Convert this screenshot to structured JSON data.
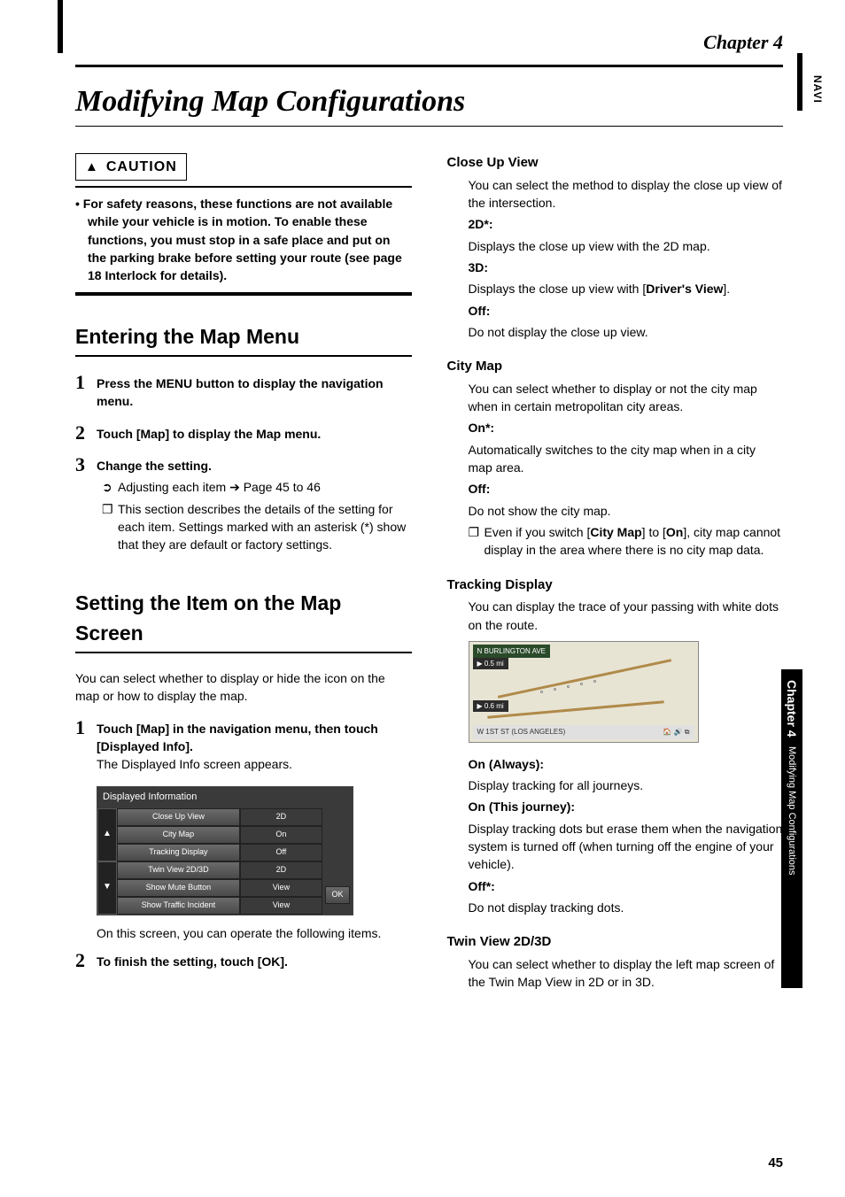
{
  "side_vert": "NAVI",
  "chapter": "Chapter 4",
  "title": "Modifying Map Configurations",
  "caution": {
    "label": "CAUTION",
    "text": "For safety reasons, these functions are not available while your vehicle is in motion. To enable these functions, you must stop in a safe place and put on the parking brake before setting your route (see page 18 Interlock for details)."
  },
  "h_enter": "Entering the Map Menu",
  "steps_a": {
    "s1": "Press the MENU button to display the navigation menu.",
    "s2": "Touch [Map] to display the Map menu.",
    "s3": "Change the setting.",
    "s3a_arrow": "Adjusting each item ➔ Page 45 to 46",
    "s3b": "This section describes the details of the setting for each item. Settings marked with an asterisk (*) show that they are default or factory settings."
  },
  "h_setting": "Setting the Item on the Map Screen",
  "setting_intro": "You can select whether to display or hide the icon on the map or how to display the map.",
  "steps_b": {
    "s1": "Touch [Map] in the navigation menu, then touch [Displayed Info].",
    "s1_sub": "The Displayed Info screen appears.",
    "s1_after": "On this screen, you can operate the following items.",
    "s2": "To finish the setting, touch [OK]."
  },
  "screenshot": {
    "title": "Displayed Information",
    "items": [
      {
        "label": "Close Up View",
        "value": "2D"
      },
      {
        "label": "City Map",
        "value": "On"
      },
      {
        "label": "Tracking Display",
        "value": "Off"
      },
      {
        "label": "Twin View 2D/3D",
        "value": "2D"
      },
      {
        "label": "Show Mute Button",
        "value": "View"
      },
      {
        "label": "Show Traffic Incident",
        "value": "View"
      }
    ],
    "ok": "OK"
  },
  "closeup": {
    "h": "Close Up View",
    "intro": "You can select the method to display the close up view of the intersection.",
    "k1": "2D*:",
    "v1": "Displays the close up view with the 2D map.",
    "k2": "3D:",
    "v2a": "Displays the close up view with [",
    "v2b": "Driver's View",
    "v2c": "].",
    "k3": "Off:",
    "v3": "Do not display the close up view."
  },
  "citymap": {
    "h": "City Map",
    "intro": "You can select whether to display or not the city map when in certain metropolitan city areas.",
    "k1": "On*:",
    "v1": "Automatically switches to the city map when in a city map area.",
    "k2": "Off:",
    "v2": "Do not show the city map.",
    "note_a": "Even if you switch [",
    "note_b": "City Map",
    "note_c": "] to [",
    "note_d": "On",
    "note_e": "], city map cannot display in the area where there is no city map data."
  },
  "tracking": {
    "h": "Tracking Display",
    "intro": "You can display the trace of your passing with white dots on the route.",
    "k1": "On (Always):",
    "v1": "Display tracking for all journeys.",
    "k2": "On (This journey):",
    "v2": "Display tracking dots but erase them when the navigation system is turned off (when turning off the engine of your vehicle).",
    "k3": "Off*:",
    "v3": "Do not display tracking dots."
  },
  "mapshot": {
    "top": "N BURLINGTON AVE",
    "mi1": "▶ 0.5 mi",
    "mi2": "▶ 0.6 mi",
    "bot_l": "W 1ST ST (LOS ANGELES)"
  },
  "twin": {
    "h": "Twin View 2D/3D",
    "intro": "You can select whether to display the left map screen of the Twin Map View in 2D or in 3D."
  },
  "side_tab": {
    "a": "Chapter 4",
    "b": "Modifying Map Configurations"
  },
  "page_num": "45"
}
